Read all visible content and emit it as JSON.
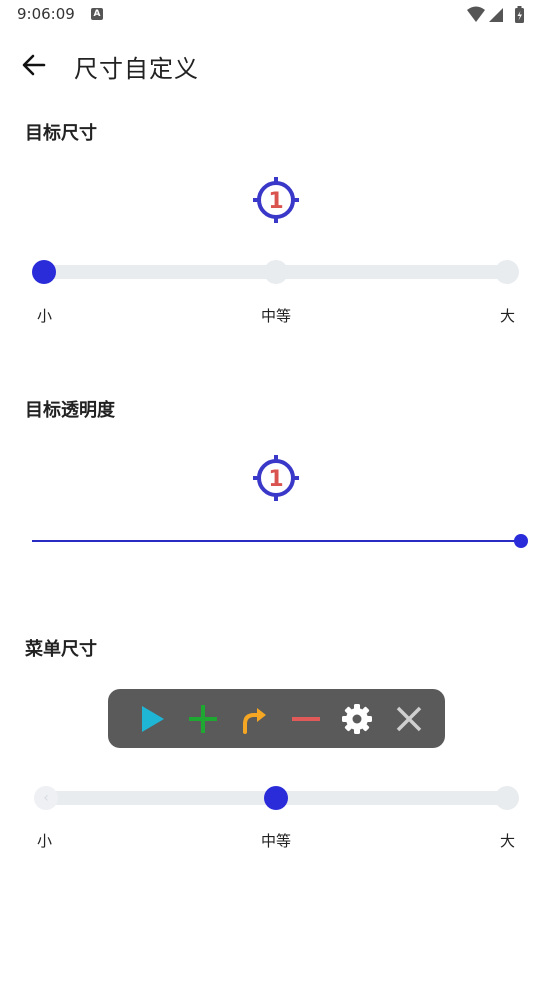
{
  "status_bar": {
    "time": "9:06:09",
    "notification_icon": "a-icon",
    "icons": [
      "wifi-icon",
      "signal-icon",
      "battery-icon"
    ]
  },
  "app_bar": {
    "back_icon": "arrow-left-icon",
    "title": "尺寸自定义"
  },
  "target_size": {
    "title": "目标尺寸",
    "preview_number": "1",
    "options": [
      "小",
      "中等",
      "大"
    ],
    "selected_index": 0
  },
  "target_opacity": {
    "title": "目标透明度",
    "preview_number": "1",
    "value_fraction": 1.0
  },
  "menu_size": {
    "title": "菜单尺寸",
    "menu_icons": [
      "play-icon",
      "plus-icon",
      "curve-arrow-icon",
      "minus-icon",
      "gear-icon",
      "close-icon"
    ],
    "options": [
      "小",
      "中等",
      "大"
    ],
    "selected_index": 1
  },
  "colors": {
    "accent": "#2a2bd9",
    "target_ring": "#3a38c8",
    "target_number": "#d9534f",
    "track": "#e9ecef",
    "menu_bg": "#5a5a5a",
    "play": "#1fb6d6",
    "plus": "#1ea832",
    "curve": "#f5a623",
    "minus": "#e05a5a",
    "gear": "#ffffff",
    "close": "#cfcfcf"
  }
}
